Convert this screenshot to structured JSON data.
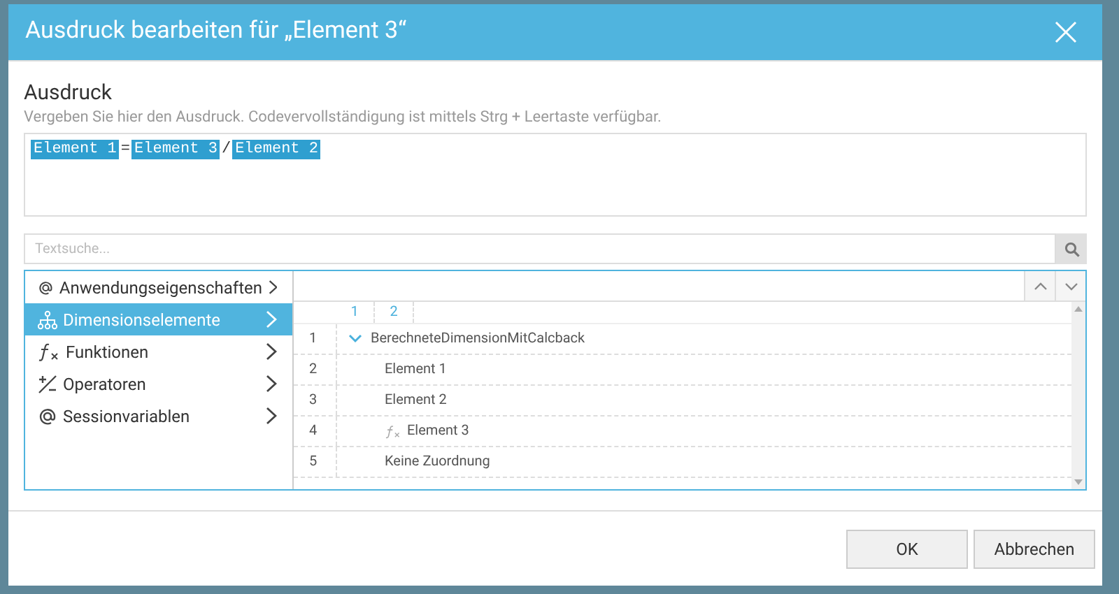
{
  "dialog": {
    "title": "Ausdruck bearbeiten für „Element 3“"
  },
  "section": {
    "heading": "Ausdruck",
    "description": "Vergeben Sie hier den Ausdruck. Codevervollständigung ist mittels Strg + Leertaste verfügbar."
  },
  "expression": [
    {
      "kind": "token",
      "text": "Element 1"
    },
    {
      "kind": "operator",
      "text": "="
    },
    {
      "kind": "token",
      "text": "Element 3"
    },
    {
      "kind": "operator",
      "text": "/"
    },
    {
      "kind": "token",
      "text": "Element 2"
    }
  ],
  "search": {
    "placeholder": "Textsuche..."
  },
  "categories": [
    {
      "kind": "properties",
      "label": "Anwendungseigenschaften",
      "selected": false
    },
    {
      "kind": "dimension",
      "label": "Dimensionselemente",
      "selected": true
    },
    {
      "kind": "function",
      "label": "Funktionen",
      "selected": false
    },
    {
      "kind": "operator",
      "label": "Operatoren",
      "selected": false
    },
    {
      "kind": "session",
      "label": "Sessionvariablen",
      "selected": false
    }
  ],
  "tree": {
    "columns": [
      "1",
      "2"
    ],
    "rows": [
      {
        "number": "1",
        "label": "BerechneteDimensionMitCalcback",
        "expanded": true,
        "children": [
          {
            "number": "2",
            "label": "Element 1"
          },
          {
            "number": "3",
            "label": "Element 2"
          },
          {
            "number": "4",
            "label": "Element 3",
            "kind": "formula"
          },
          {
            "number": "5",
            "label": "Keine Zuordnung"
          }
        ]
      }
    ]
  },
  "buttons": [
    "OK",
    "Abbrechen"
  ]
}
